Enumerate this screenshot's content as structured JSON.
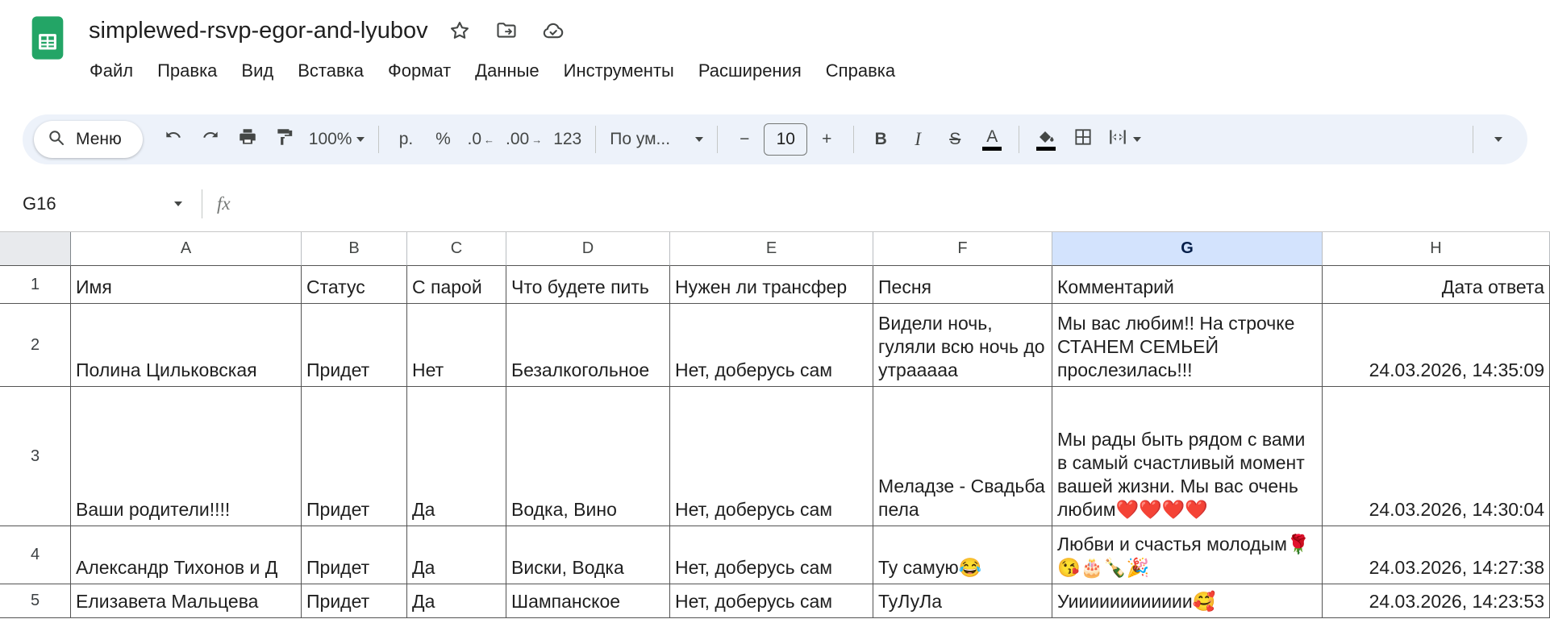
{
  "colors": {
    "toolbar_bg": "#edf2fa",
    "selected_column_bg": "#d3e3fd",
    "logo_green": "#23a566",
    "text_color_bar": "#000000"
  },
  "header": {
    "title": "simplewed-rsvp-egor-and-lyubov",
    "menus": [
      {
        "key": "file",
        "label": "Файл"
      },
      {
        "key": "edit",
        "label": "Правка"
      },
      {
        "key": "view",
        "label": "Вид"
      },
      {
        "key": "insert",
        "label": "Вставка"
      },
      {
        "key": "format",
        "label": "Формат"
      },
      {
        "key": "data",
        "label": "Данные"
      },
      {
        "key": "tools",
        "label": "Инструменты"
      },
      {
        "key": "extensions",
        "label": "Расширения"
      },
      {
        "key": "help",
        "label": "Справка"
      }
    ],
    "icons": [
      "sheets-logo",
      "star-icon",
      "move-to-folder-icon",
      "cloud-saved-icon"
    ]
  },
  "toolbar": {
    "search_label": "Меню",
    "zoom_value": "100%",
    "format_currency": "р.",
    "format_percent": "%",
    "decrease_decimals": ".0",
    "increase_decimals": ".00",
    "more_formats": "123",
    "font_name": "По ум...",
    "font_size": "10",
    "bold": "B",
    "italic": "I",
    "strikethrough": "S",
    "text_color": "A",
    "icons": [
      "search-icon",
      "undo-icon",
      "redo-icon",
      "print-icon",
      "paint-format-icon",
      "fill-color-icon",
      "borders-icon",
      "merge-cells-icon",
      "more-icon"
    ]
  },
  "formula_bar": {
    "cell_reference": "G16",
    "fx_label": "fx"
  },
  "grid": {
    "column_headers": [
      "A",
      "B",
      "C",
      "D",
      "E",
      "F",
      "G",
      "H"
    ],
    "selected_column": "G",
    "rows": [
      {
        "n": "1",
        "cells": [
          "Имя",
          "Статус",
          "С парой",
          "Что будете пить",
          "Нужен ли трансфер",
          "Песня",
          "Комментарий",
          "Дата ответа"
        ]
      },
      {
        "n": "2",
        "cells": [
          "Полина Цильковская",
          "Придет",
          "Нет",
          "Безалкогольное",
          "Нет, доберусь сам",
          "Видели ночь, гуляли всю ночь до утрааааа",
          "Мы вас любим!! На строчке СТАНЕМ СЕМЬЕЙ прослезилась!!!",
          "24.03.2026, 14:35:09"
        ]
      },
      {
        "n": "3",
        "cells": [
          "Ваши родители!!!!",
          "Придет",
          "Да",
          "Водка, Вино",
          "Нет, доберусь сам",
          "Меладзе - Свадьба пела",
          "Мы рады быть рядом с вами в самый счастливый момент вашей жизни. Мы вас очень любим❤️❤️❤️❤️",
          "24.03.2026, 14:30:04"
        ]
      },
      {
        "n": "4",
        "cells": [
          "Александр Тихонов и Д",
          "Придет",
          "Да",
          "Виски, Водка",
          "Нет, доберусь сам",
          "Ту самую😂",
          "Любви и счастья молодым🌹😘🎂🍾🎉",
          "24.03.2026, 14:27:38"
        ]
      },
      {
        "n": "5",
        "cells": [
          "Елизавета Мальцева",
          "Придет",
          "Да",
          "Шампанское",
          "Нет, доберусь сам",
          "ТуЛуЛа",
          "Уииииииииииии🥰",
          "24.03.2026, 14:23:53"
        ]
      }
    ]
  }
}
